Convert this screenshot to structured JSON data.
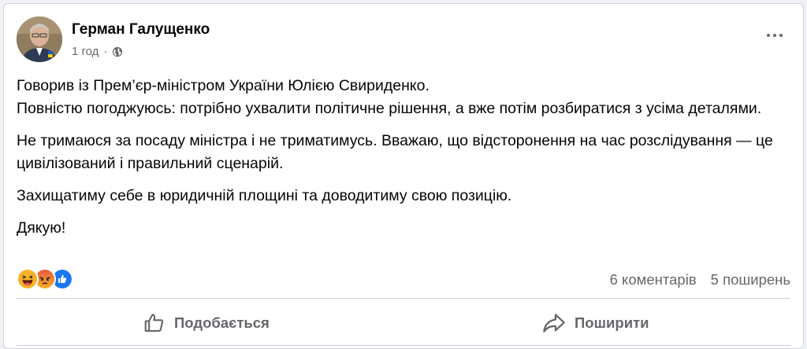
{
  "post": {
    "author": "Герман Галущенко",
    "time": "1 год",
    "separator": "·",
    "privacy_icon": "globe-icon",
    "more_icon": "more-dots-icon",
    "paragraphs": [
      "Говорив із Прем’єр-міністром України Юлією Свириденко.",
      "Повністю погоджуюсь: потрібно ухвалити політичне рішення, а вже потім розбиратися з усіма деталями.",
      "Не тримаюся за посаду міністра і не триматимусь. Вважаю, що відсторонення на час розслідування — це цивілізований і правильний сценарій.",
      "Захищатиму себе в юридичній площині та доводитиму свою позицію.",
      "Дякую!"
    ]
  },
  "engagement": {
    "reactions": [
      "haha",
      "angry",
      "like"
    ],
    "comments": "6 коментарів",
    "shares": "5 поширень"
  },
  "actions": {
    "like_label": "Подобається",
    "share_label": "Поширити"
  },
  "colors": {
    "secondary_text": "#65676b",
    "like_blue": "#1877f2",
    "angry_red": "#e9573f",
    "haha_yellow": "#f7b125"
  }
}
